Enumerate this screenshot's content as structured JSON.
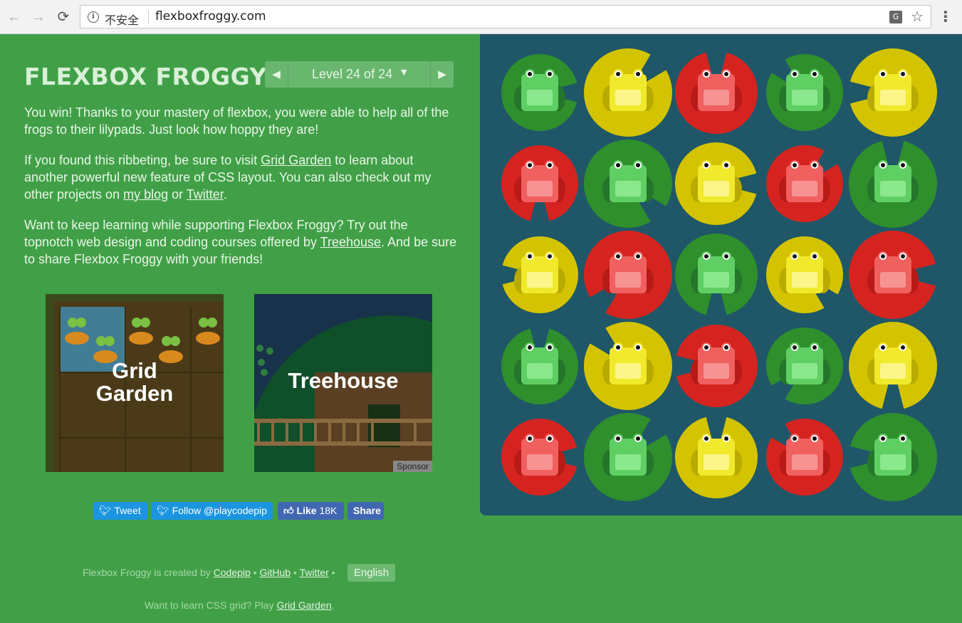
{
  "browser": {
    "security_label": "不安全",
    "url": "flexboxfroggy.com",
    "icons": [
      "back-icon",
      "forward-icon",
      "reload-icon",
      "info-icon",
      "translate-icon",
      "star-icon",
      "menu-icon"
    ]
  },
  "header": {
    "logo": "FLEXBOX FROGGY",
    "level_text": "Level 24 of 24",
    "prev": "◀",
    "next": "▶",
    "caret": "▼"
  },
  "content": {
    "p1": "You win! Thanks to your mastery of flexbox, you were able to help all of the frogs to their lilypads. Just look how hoppy they are!",
    "p2_before": "If you found this ribbeting, be sure to visit ",
    "p2_link1": "Grid Garden",
    "p2_mid": " to learn about another powerful new feature of CSS layout. You can also check out my other projects on ",
    "p2_link2": "my blog",
    "p2_or": " or ",
    "p2_link3": "Twitter",
    "p2_end": ".",
    "p3_before": "Want to keep learning while supporting Flexbox Froggy? Try out the topnotch web design and coding courses offered by ",
    "p3_link": "Treehouse",
    "p3_end": ". And be sure to share Flexbox Froggy with your friends!"
  },
  "promos": {
    "grid_garden_line1": "Grid",
    "grid_garden_line2": "Garden",
    "treehouse": "Treehouse",
    "sponsor": "Sponsor"
  },
  "social": {
    "tweet": "Tweet",
    "follow": "Follow @playcodepip",
    "like": "Like",
    "like_count": "18K",
    "share": "Share"
  },
  "footer": {
    "created_by": "Flexbox Froggy is created by ",
    "codepip": "Codepip",
    "dot": " • ",
    "github": "GitHub",
    "twitter": "Twitter",
    "language": "English",
    "learn_grid": "Want to learn CSS grid? Play ",
    "grid_garden": "Grid Garden",
    "period": "."
  },
  "pond": {
    "colors": {
      "green": "#2f8f2e",
      "yellow": "#d4c400",
      "red": "#d2201c",
      "water": "#1f5768"
    },
    "rows": [
      [
        "green",
        "yellow",
        "red",
        "green",
        "yellow"
      ],
      [
        "red",
        "green",
        "yellow",
        "red",
        "green"
      ],
      [
        "yellow",
        "red",
        "green",
        "yellow",
        "red"
      ],
      [
        "green",
        "yellow",
        "red",
        "green",
        "yellow"
      ],
      [
        "red",
        "green",
        "yellow",
        "red",
        "green"
      ]
    ]
  }
}
